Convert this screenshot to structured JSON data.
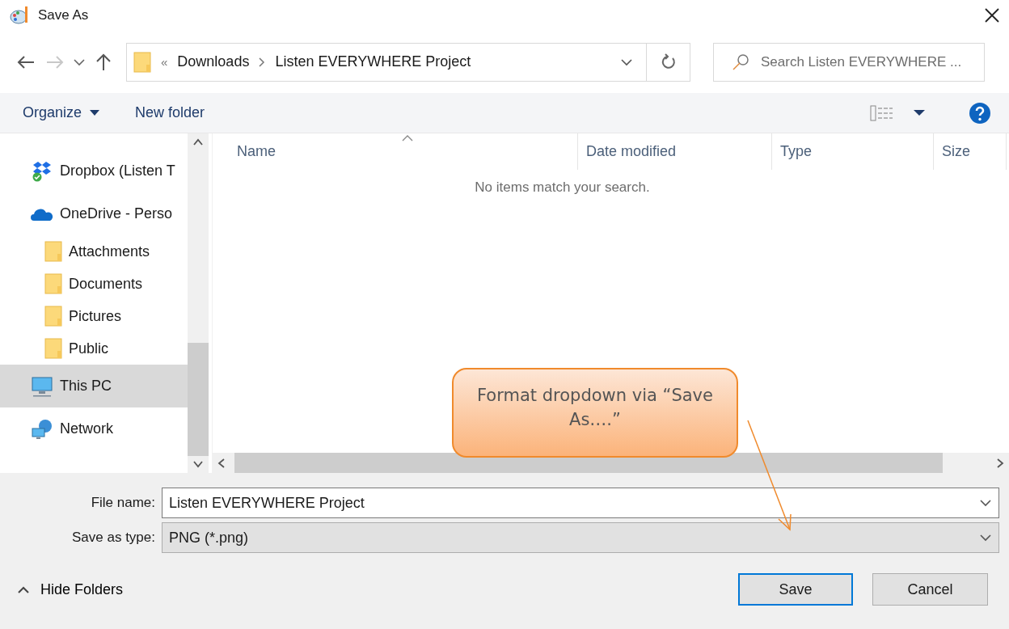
{
  "window": {
    "title": "Save As"
  },
  "address": {
    "overflow": "«",
    "path": [
      {
        "label": "Downloads"
      },
      {
        "label": "Listen EVERYWHERE Project"
      }
    ]
  },
  "search": {
    "placeholder": "Search Listen EVERYWHERE ..."
  },
  "toolbar": {
    "organize": "Organize",
    "new_folder": "New folder"
  },
  "sidebar": {
    "items": [
      {
        "kind": "dropbox",
        "label": "Dropbox (Listen T",
        "selected": false
      },
      {
        "kind": "cloud",
        "label": "OneDrive - Perso",
        "selected": false,
        "children": [
          {
            "kind": "folder",
            "label": "Attachments",
            "selected": false
          },
          {
            "kind": "folder",
            "label": "Documents",
            "selected": false
          },
          {
            "kind": "folder",
            "label": "Pictures",
            "selected": false
          },
          {
            "kind": "folder",
            "label": "Public",
            "selected": false
          }
        ]
      },
      {
        "kind": "pc",
        "label": "This PC",
        "selected": true
      },
      {
        "kind": "network",
        "label": "Network",
        "selected": false
      }
    ]
  },
  "table": {
    "columns": [
      "Name",
      "Date modified",
      "Type",
      "Size"
    ],
    "empty_message": "No items match your search."
  },
  "form": {
    "file_name": {
      "label": "File name:",
      "value": "Listen EVERYWHERE Project"
    },
    "save_as_type": {
      "label": "Save as type:",
      "value": "PNG (*.png)"
    }
  },
  "hide_folders": "Hide Folders",
  "buttons": [
    {
      "label": "Save",
      "default": true
    },
    {
      "label": "Cancel",
      "default": false
    }
  ],
  "callout": {
    "text": "Format dropdown via “Save As….”"
  }
}
